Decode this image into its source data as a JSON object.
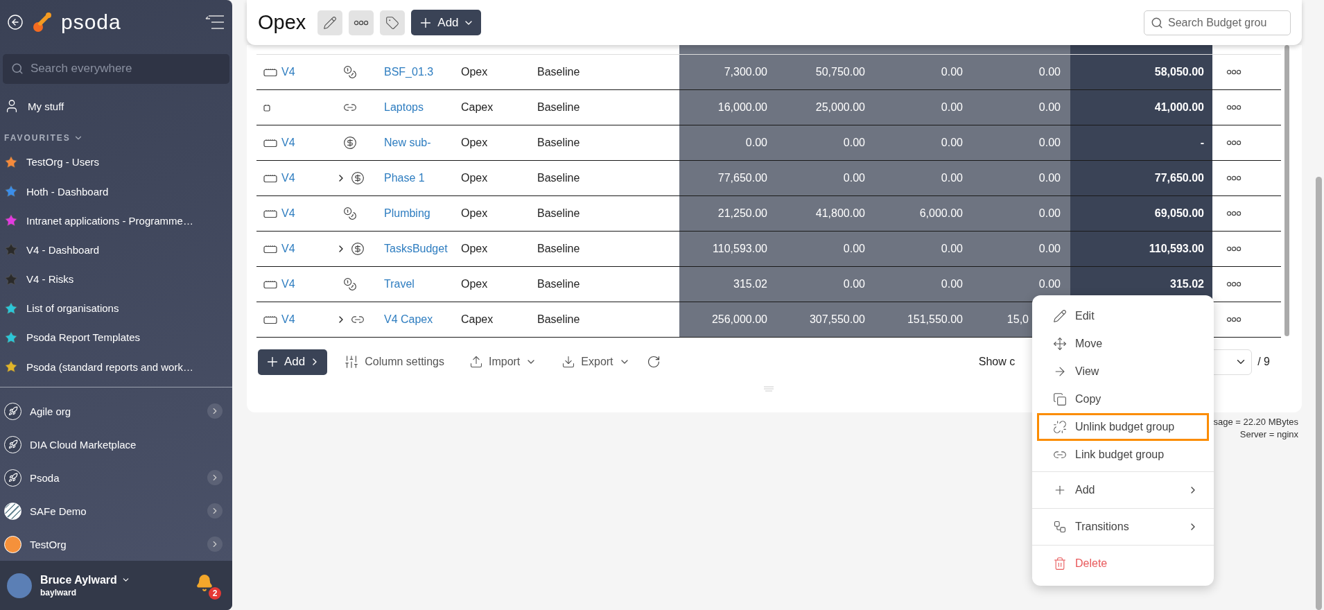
{
  "sidebar": {
    "logo": "psoda",
    "search": {
      "placeholder": "Search everywhere"
    },
    "my_stuff": "My stuff",
    "favourites_heading": "FAVOURITES",
    "favourites": [
      {
        "label": "TestOrg - Users",
        "color": "#f58a3c"
      },
      {
        "label": "Hoth - Dashboard",
        "color": "#3b8de8"
      },
      {
        "label": "Intranet applications - Programme…",
        "color": "#e23be0"
      },
      {
        "label": "V4 - Dashboard",
        "color": "#2a2a2a"
      },
      {
        "label": "V4 - Risks",
        "color": "#2a2a2a"
      },
      {
        "label": "List of organisations",
        "color": "#2cc6d8"
      },
      {
        "label": "Psoda Report Templates",
        "color": "#2cc6d8"
      },
      {
        "label": "Psoda (standard reports and work…",
        "color": "#e1b52a"
      }
    ],
    "organisations": [
      {
        "label": "Agile org",
        "kind": "rocket",
        "has_children": true
      },
      {
        "label": "DIA Cloud Marketplace",
        "kind": "rocket",
        "has_children": false
      },
      {
        "label": "Psoda",
        "kind": "rocket",
        "has_children": true
      },
      {
        "label": "SAFe Demo",
        "kind": "stripes",
        "has_children": true
      },
      {
        "label": "TestOrg",
        "kind": "sun",
        "has_children": true
      }
    ],
    "user": {
      "name": "Bruce Aylward",
      "username": "baylward",
      "notifications": "2"
    }
  },
  "header": {
    "title": "Opex",
    "add_button": "Add",
    "search": {
      "placeholder": "Search Budget grou"
    }
  },
  "table": {
    "rows": [
      {
        "version": "V4",
        "kind": "coins",
        "expandable": false,
        "name": "BSF_01.3",
        "type": "Opex",
        "scenario": "Baseline",
        "values": [
          "7,300.00",
          "50,750.00",
          "0.00",
          "0.00"
        ],
        "total": "58,050.00"
      },
      {
        "kind": "link",
        "expandable": false,
        "name": "Laptops",
        "type": "Capex",
        "scenario": "Baseline",
        "values": [
          "16,000.00",
          "25,000.00",
          "0.00",
          "0.00"
        ],
        "total": "41,000.00"
      },
      {
        "version": "V4",
        "kind": "money",
        "expandable": false,
        "name": "New sub-",
        "type": "Opex",
        "scenario": "Baseline",
        "values": [
          "0.00",
          "0.00",
          "0.00",
          "0.00"
        ],
        "total": "-"
      },
      {
        "version": "V4",
        "kind": "money",
        "expandable": true,
        "name": "Phase 1",
        "type": "Opex",
        "scenario": "Baseline",
        "values": [
          "77,650.00",
          "0.00",
          "0.00",
          "0.00"
        ],
        "total": "77,650.00"
      },
      {
        "version": "V4",
        "kind": "coins",
        "expandable": false,
        "name": "Plumbing",
        "type": "Opex",
        "scenario": "Baseline",
        "values": [
          "21,250.00",
          "41,800.00",
          "6,000.00",
          "0.00"
        ],
        "total": "69,050.00"
      },
      {
        "version": "V4",
        "kind": "money",
        "expandable": true,
        "name": "TasksBudget",
        "type": "Opex",
        "scenario": "Baseline",
        "values": [
          "110,593.00",
          "0.00",
          "0.00",
          "0.00"
        ],
        "total": "110,593.00"
      },
      {
        "version": "V4",
        "kind": "coins",
        "expandable": false,
        "name": "Travel",
        "type": "Opex",
        "scenario": "Baseline",
        "values": [
          "315.02",
          "0.00",
          "0.00",
          "0.00"
        ],
        "total": "315.02"
      },
      {
        "version": "V4",
        "kind": "link",
        "expandable": true,
        "name": "V4 Capex",
        "type": "Capex",
        "scenario": "Baseline",
        "values": [
          "256,000.00",
          "307,550.00",
          "151,550.00",
          "15,0"
        ]
      }
    ],
    "toolbar": {
      "add": "Add",
      "column_settings": "Column settings",
      "import": "Import",
      "export": "Export"
    },
    "pager": {
      "show_label": "Show c",
      "total_pages": "/ 9"
    }
  },
  "context_menu": {
    "groups": [
      [
        {
          "label": "Edit",
          "kind": "action",
          "highlighted": false
        },
        {
          "label": "Move",
          "kind": "action",
          "highlighted": false
        },
        {
          "label": "View",
          "kind": "action",
          "highlighted": false
        },
        {
          "label": "Copy",
          "kind": "action",
          "highlighted": false
        },
        {
          "label": "Unlink budget group",
          "kind": "action",
          "highlighted": true
        },
        {
          "label": "Link budget group",
          "kind": "action",
          "highlighted": false
        }
      ],
      [
        {
          "label": "Add",
          "kind": "submenu",
          "highlighted": false
        }
      ],
      [
        {
          "label": "Transitions",
          "kind": "submenu",
          "highlighted": false
        }
      ],
      [
        {
          "label": "Delete",
          "kind": "danger",
          "highlighted": false
        }
      ]
    ]
  },
  "footer": [
    "sage = 22.20 MBytes",
    "Server = nginx"
  ]
}
